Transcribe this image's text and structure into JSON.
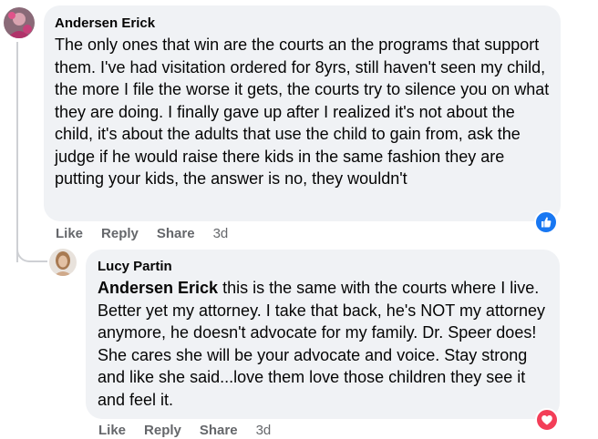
{
  "comment": {
    "author": "Andersen Erick",
    "text": "The only ones that win are the courts an the programs that support them. I've had visitation ordered for 8yrs, still haven't seen my child, the more I file the worse it gets, the courts try to silence you on what they are doing. I finally gave up after I realized it's not about the child, it's about the adults that use the child to gain from, ask the judge if he would raise there kids in the same fashion they are putting your kids, the answer is no, they wouldn't",
    "actions": {
      "like": "Like",
      "reply": "Reply",
      "share": "Share",
      "time": "3d"
    },
    "reaction_icon": "like-icon",
    "reaction_color": "#1877f2"
  },
  "reply": {
    "author": "Lucy Partin",
    "mention": "Andersen Erick",
    "text": " this is the same with the courts where I live. Better yet my attorney. I take that back, he's NOT my attorney anymore, he doesn't advocate for my family. Dr. Speer does! She cares she will be your advocate and voice. Stay strong and like she said...love them love those children they see it and feel it.",
    "actions": {
      "like": "Like",
      "reply": "Reply",
      "share": "Share",
      "time": "3d"
    },
    "reaction_icon": "love-icon",
    "reaction_color": "#f33e58"
  }
}
